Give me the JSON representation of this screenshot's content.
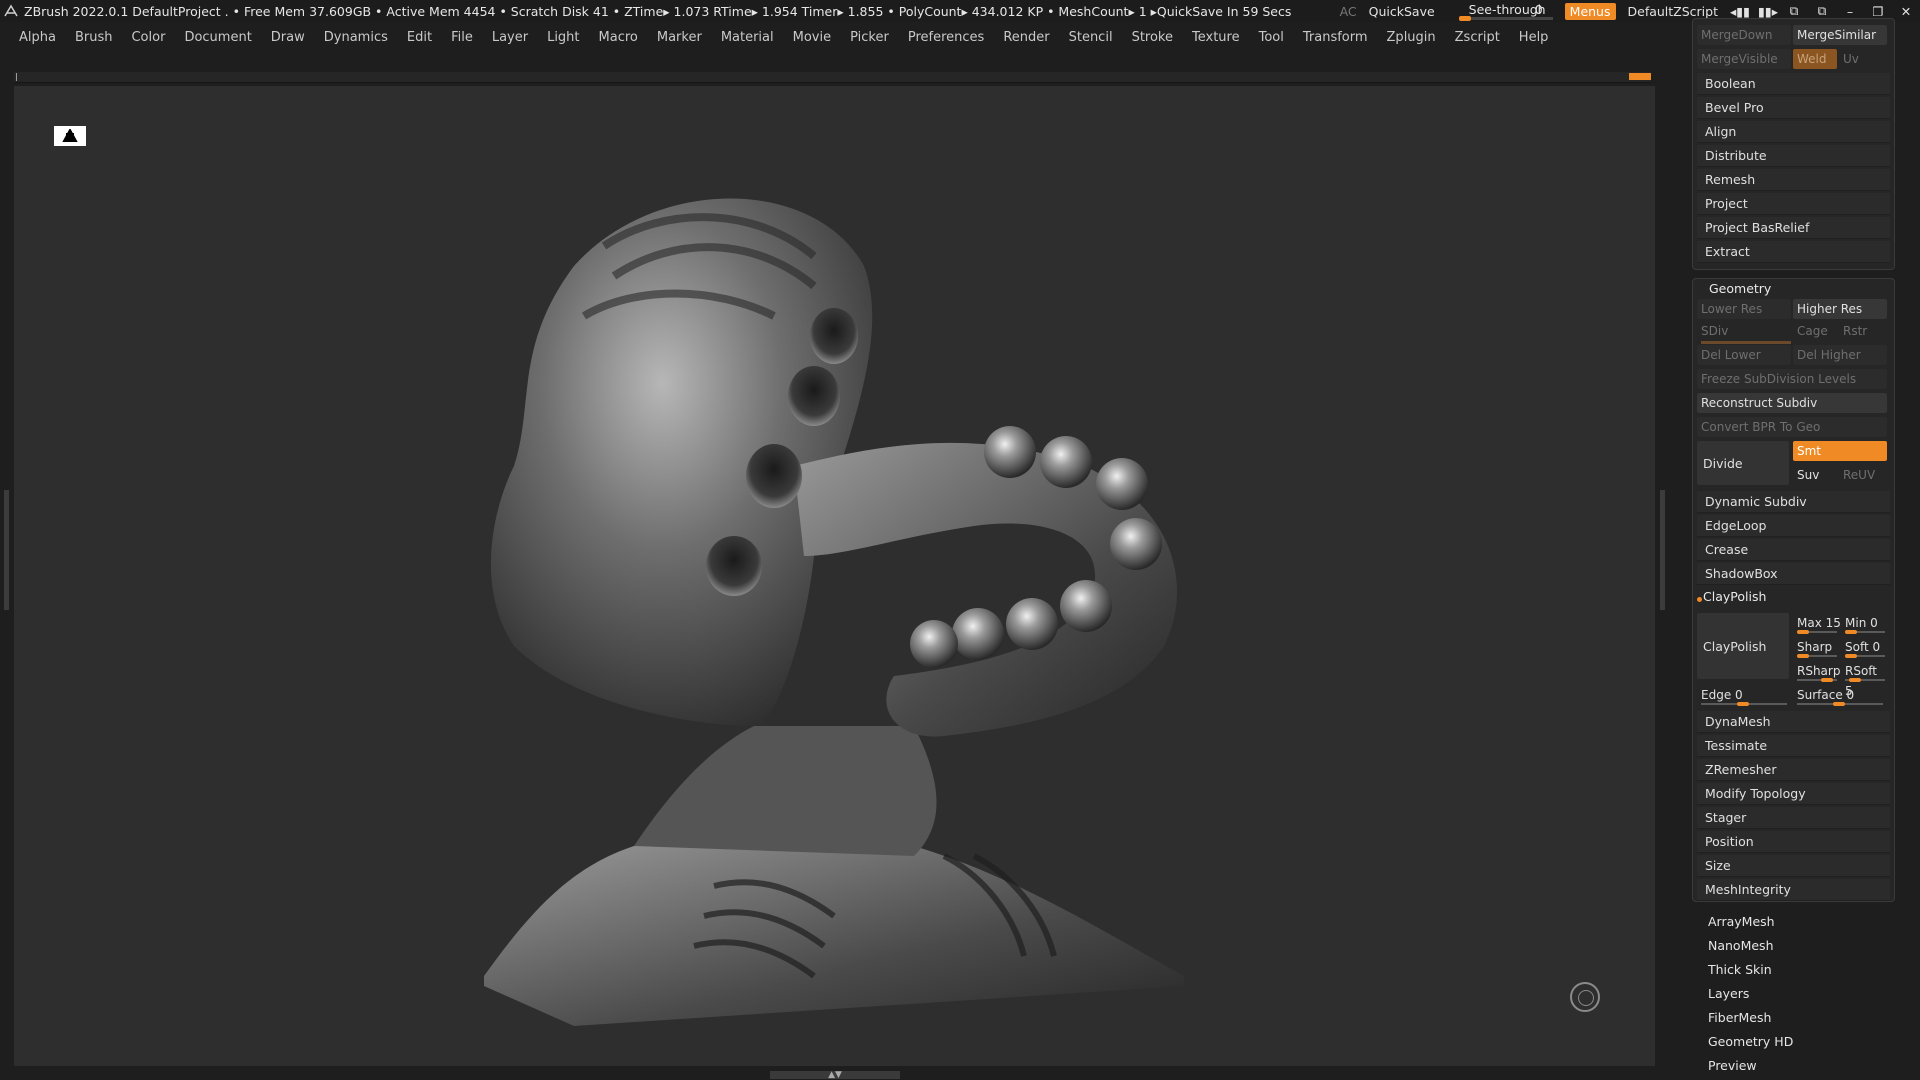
{
  "title_bar": {
    "text": "ZBrush 2022.0.1    DefaultProject    . • Free Mem 37.609GB • Active Mem 4454 • Scratch Disk 41 •   ZTime▸ 1.073 RTime▸ 1.954 Timer▸ 1.855 • PolyCount▸ 434.012 KP  • MeshCount▸ 1   ▸QuickSave In 59 Secs",
    "ac": "AC",
    "quicksave": "QuickSave",
    "see_through_label": "See-through",
    "see_through_value": "0",
    "see_through_level": 0,
    "menus": "Menus",
    "default_zscript": "DefaultZScript"
  },
  "menu_bar": [
    "Alpha",
    "Brush",
    "Color",
    "Document",
    "Draw",
    "Dynamics",
    "Edit",
    "File",
    "Layer",
    "Light",
    "Macro",
    "Marker",
    "Material",
    "Movie",
    "Picker",
    "Preferences",
    "Render",
    "Stencil",
    "Stroke",
    "Texture",
    "Tool",
    "Transform",
    "Zplugin",
    "Zscript",
    "Help"
  ],
  "subtool_panel": {
    "merge_down": "MergeDown",
    "merge_similar": "MergeSimilar",
    "merge_visible": "MergeVisible",
    "weld": "Weld",
    "uv": "Uv",
    "items": [
      "Boolean",
      "Bevel Pro",
      "Align",
      "Distribute",
      "Remesh",
      "Project",
      "Project BasRelief",
      "Extract"
    ]
  },
  "geometry": {
    "header": "Geometry",
    "lower_res": "Lower Res",
    "higher_res": "Higher Res",
    "sdiv": "SDiv",
    "cage": "Cage",
    "rstr": "Rstr",
    "del_lower": "Del Lower",
    "del_higher": "Del Higher",
    "freeze": "Freeze SubDivision Levels",
    "reconstruct": "Reconstruct Subdiv",
    "convert_bpr": "Convert BPR To Geo",
    "divide": "Divide",
    "smt": "Smt",
    "suv": "Suv",
    "reuv": "ReUV",
    "items_a": [
      "Dynamic Subdiv",
      "EdgeLoop",
      "Crease",
      "ShadowBox"
    ],
    "claypolish_header": "ClayPolish",
    "claypolish_btn": "ClayPolish",
    "max": "Max 15",
    "min": "Min 0",
    "sharp": "Sharp",
    "soft": "Soft 0",
    "rsharp": "RSharp",
    "rsoft": "RSoft 5",
    "edge": "Edge 0",
    "surface": "Surface 0",
    "items_b": [
      "DynaMesh",
      "Tessimate",
      "ZRemesher",
      "Modify Topology",
      "Stager",
      "Position",
      "Size",
      "MeshIntegrity"
    ]
  },
  "tool_list": [
    "ArrayMesh",
    "NanoMesh",
    "Thick Skin",
    "Layers",
    "FiberMesh",
    "Geometry HD",
    "Preview"
  ],
  "colors": {
    "accent": "#f08a24",
    "bg": "#1e1e1e",
    "viewport": "#2e2e2e"
  }
}
